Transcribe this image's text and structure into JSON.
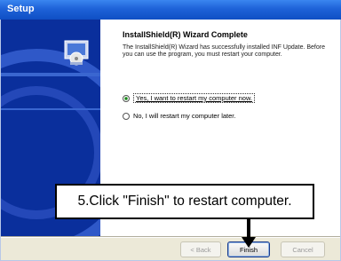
{
  "window": {
    "title": "Setup"
  },
  "wizard": {
    "heading": "InstallShield(R) Wizard Complete",
    "body": "The InstallShield(R) Wizard has successfully installed INF Update. Before you can use the program, you must restart your computer.",
    "options": [
      {
        "label": "Yes, I want to restart my computer now.",
        "selected": true
      },
      {
        "label": "No, I will restart my computer later.",
        "selected": false
      }
    ],
    "buttons": {
      "back": "< Back",
      "finish": "Finish",
      "cancel": "Cancel"
    }
  },
  "callout": {
    "text": "5.Click \"Finish\" to restart computer."
  },
  "icons": {
    "setup_icon": "monitor-cd-icon"
  }
}
